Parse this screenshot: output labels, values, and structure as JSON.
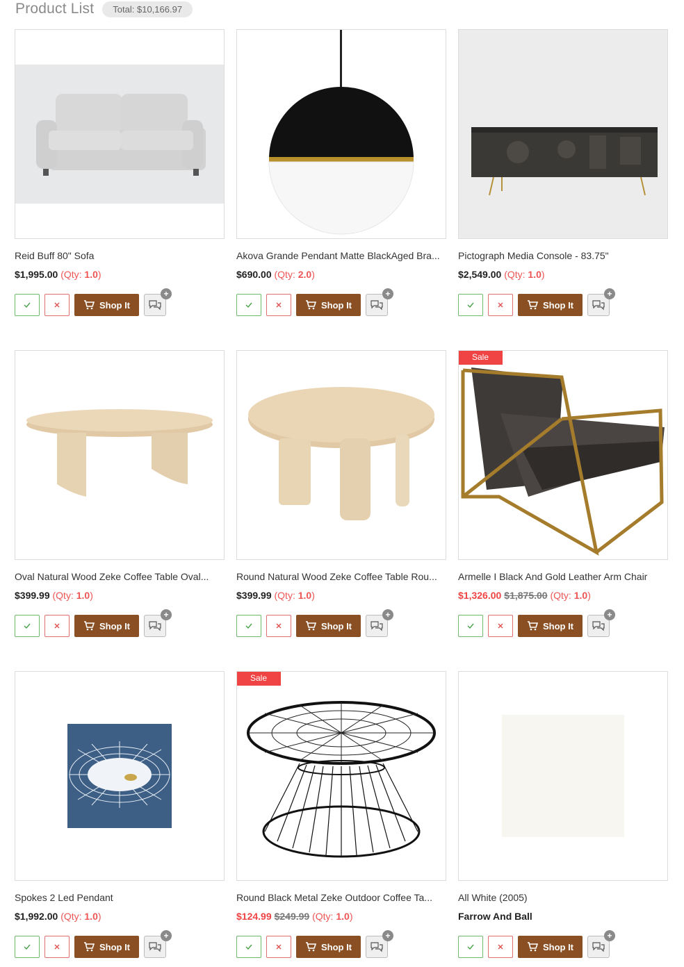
{
  "header": {
    "title": "Product List",
    "total": "Total: $10,166.97"
  },
  "labels": {
    "shop": "Shop It",
    "qty_prefix": "(Qty: ",
    "qty_suffix": ")",
    "sale": "Sale",
    "plus": "+"
  },
  "products": [
    {
      "name": "Reid Buff 80\" Sofa",
      "price": "$1,995.00",
      "qty": "1.0"
    },
    {
      "name": "Akova Grande Pendant Matte BlackAged Bra...",
      "price": "$690.00",
      "qty": "2.0"
    },
    {
      "name": "Pictograph Media Console - 83.75\"",
      "price": "$2,549.00",
      "qty": "1.0"
    },
    {
      "name": "Oval Natural Wood Zeke Coffee Table Oval...",
      "price": "$399.99",
      "qty": "1.0"
    },
    {
      "name": "Round Natural Wood Zeke Coffee Table Rou...",
      "price": "$399.99",
      "qty": "1.0"
    },
    {
      "name": "Armelle I Black And Gold Leather Arm Chair",
      "price": "$1,326.00",
      "old_price": "$1,875.00",
      "qty": "1.0",
      "sale": true
    },
    {
      "name": "Spokes 2 Led Pendant",
      "price": "$1,992.00",
      "qty": "1.0"
    },
    {
      "name": "Round Black Metal Zeke Outdoor Coffee Ta...",
      "price": "$124.99",
      "old_price": "$249.99",
      "qty": "1.0",
      "sale": true
    },
    {
      "name": "All White (2005)",
      "brand": "Farrow And Ball"
    }
  ],
  "colors": {
    "shop_button": "#8a5024",
    "sale": "#f04343",
    "qty": "#e55555",
    "accept": "#4aa24a",
    "reject": "#e05050"
  },
  "icons": {
    "accept": "check-icon",
    "reject": "close-icon",
    "shop": "cart-icon",
    "chat": "chat-bubbles-icon",
    "plus": "plus-icon"
  }
}
